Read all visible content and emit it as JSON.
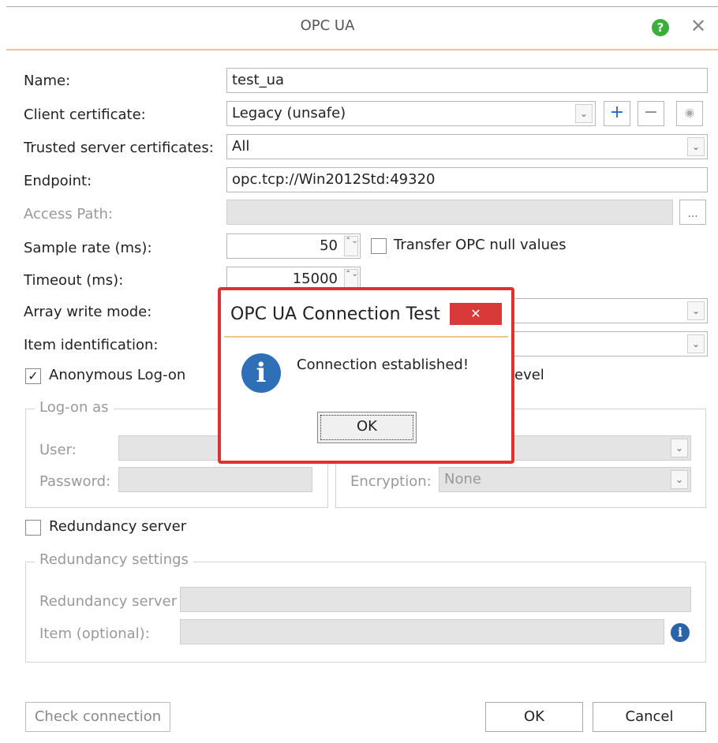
{
  "window": {
    "title": "OPC UA",
    "help_glyph": "?",
    "close_glyph": "✕"
  },
  "form": {
    "name": {
      "label": "Name:",
      "value": "test_ua"
    },
    "client_certificate": {
      "label": "Client certificate:",
      "value": "Legacy (unsafe)",
      "add_glyph": "+",
      "remove_glyph": "−",
      "view_glyph": "◉"
    },
    "trusted_server_certificates": {
      "label": "Trusted server certificates:",
      "value": "All"
    },
    "endpoint": {
      "label": "Endpoint:",
      "value": "opc.tcp://Win2012Std:49320"
    },
    "access_path": {
      "label": "Access Path:",
      "value": "",
      "browse_glyph": "..."
    },
    "sample_rate": {
      "label": "Sample rate (ms):",
      "value": "50"
    },
    "transfer_null": {
      "label": "Transfer OPC null values",
      "checked": false
    },
    "timeout": {
      "label": "Timeout (ms):",
      "value": "15000"
    },
    "array_write_mode": {
      "label": "Array write mode:",
      "value": ""
    },
    "item_identification": {
      "label": "Item identification:",
      "value": ""
    },
    "anonymous_logon": {
      "label": "Anonymous Log-on",
      "checked": true,
      "check_glyph": "✓"
    },
    "security_level_partial": "evel",
    "logon_group": {
      "title": "Log-on as",
      "user_label": "User:",
      "password_label": "Password:"
    },
    "encryption": {
      "label": "Encryption:",
      "value": "None"
    },
    "redundancy_server_check": {
      "label": "Redundancy server",
      "checked": false
    },
    "redundancy_group": {
      "title": "Redundancy settings",
      "server_label": "Redundancy server",
      "item_label": "Item (optional):"
    }
  },
  "footer": {
    "check_connection": "Check connection",
    "ok": "OK",
    "cancel": "Cancel"
  },
  "dialog": {
    "title": "OPC UA Connection Test",
    "close_glyph": "✕",
    "message": "Connection established!",
    "ok": "OK",
    "info_glyph": "i"
  },
  "icons": {
    "combo_arrow": "⌄",
    "spin": "⌃⌄"
  },
  "colors": {
    "accent_line": "#f3c48a",
    "dialog_border": "#e03030",
    "info_blue": "#2f6fb8",
    "help_green": "#3cae3c"
  }
}
